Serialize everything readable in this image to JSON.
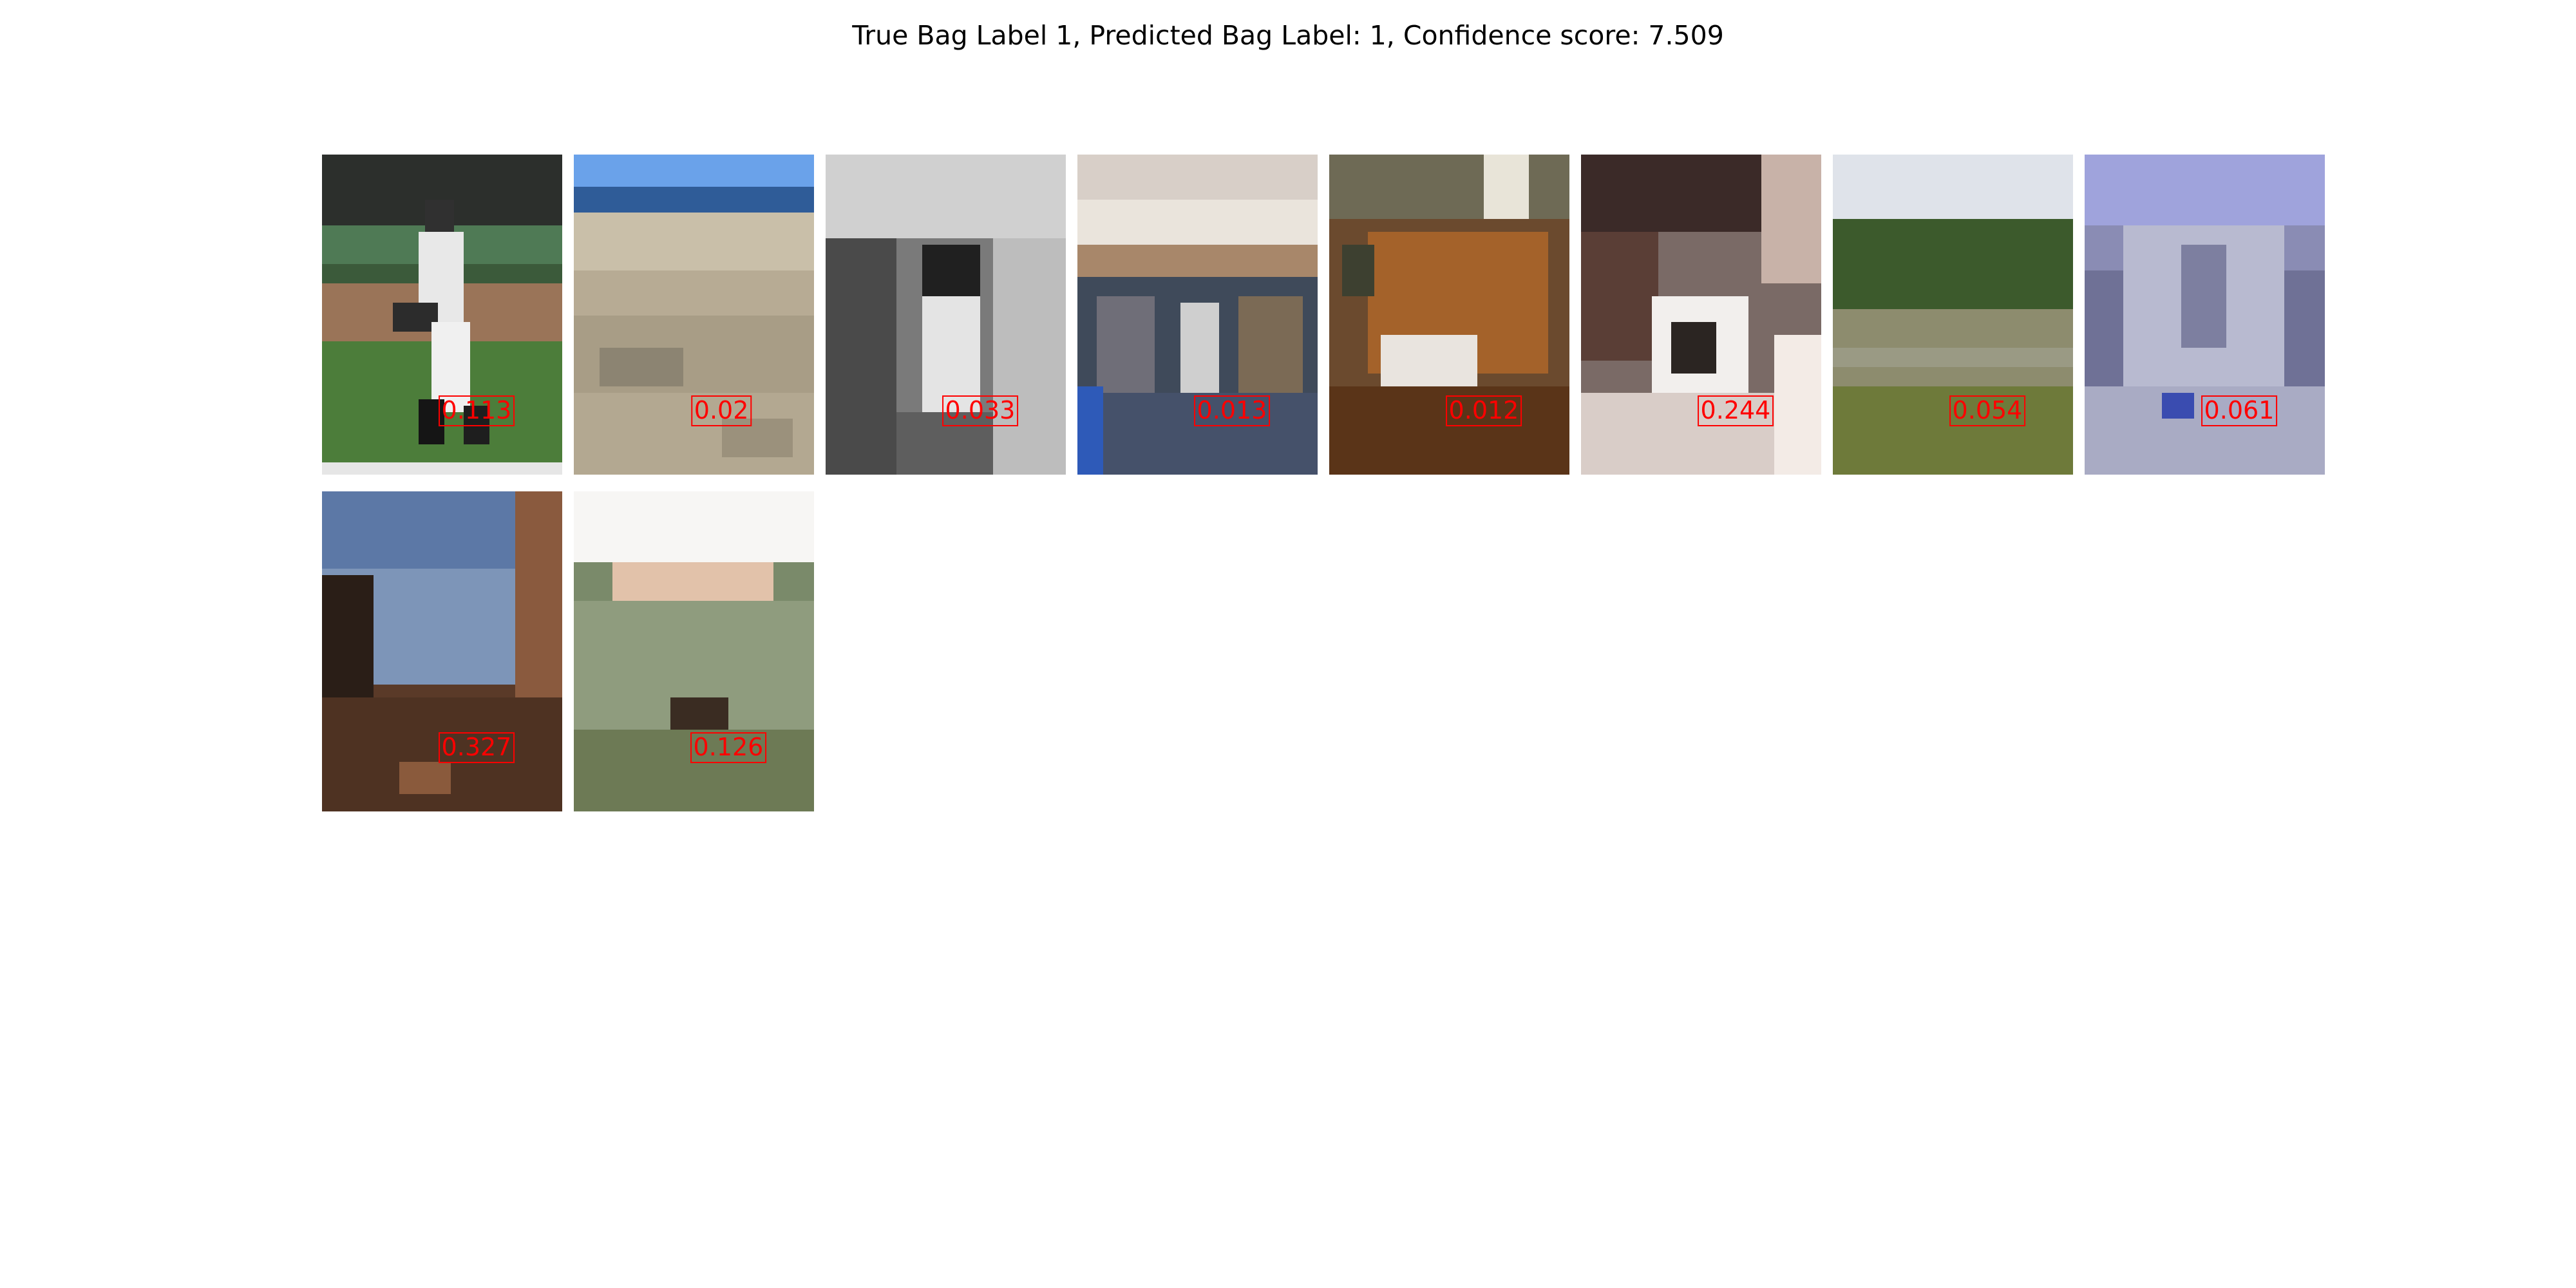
{
  "title": "True Bag Label 1, Predicted Bag Label: 1, Confidence score: 7.509",
  "instances": [
    {
      "score": "0.113",
      "scene": "baseball-pitcher"
    },
    {
      "score": "0.02",
      "scene": "sandy-shore"
    },
    {
      "score": "0.033",
      "scene": "grayscale-interior"
    },
    {
      "score": "0.013",
      "scene": "shop-interior"
    },
    {
      "score": "0.012",
      "scene": "wooden-furniture-room"
    },
    {
      "score": "0.244",
      "scene": "people-indoors"
    },
    {
      "score": "0.054",
      "scene": "grassy-field-trees"
    },
    {
      "score": "0.061",
      "scene": "building-facade"
    },
    {
      "score": "0.327",
      "scene": "canyon-sky"
    },
    {
      "score": "0.126",
      "scene": "tall-grass-sunset"
    }
  ],
  "colors": {
    "score_text": "#ff0000",
    "title_text": "#000000"
  }
}
